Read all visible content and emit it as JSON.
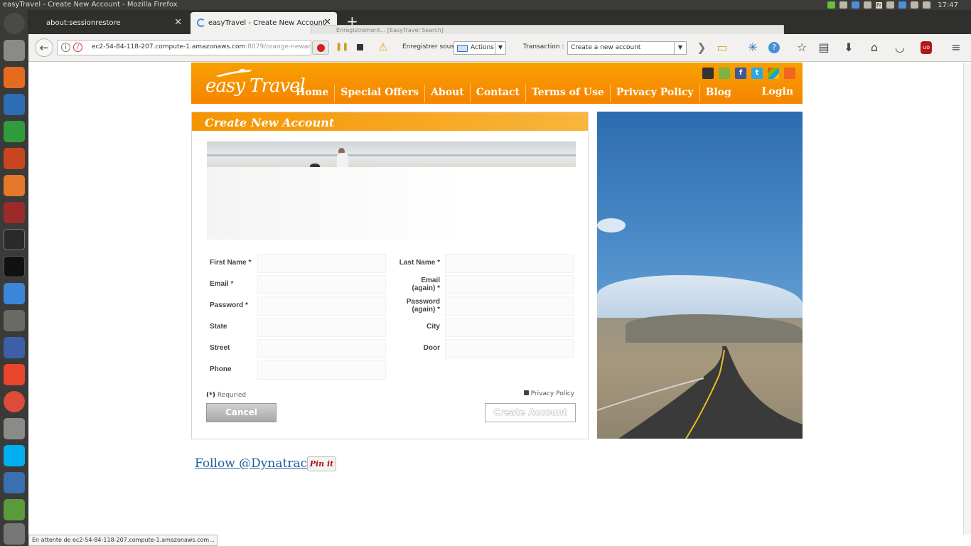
{
  "window": {
    "title": "easyTravel - Create New Account - Mozilla Firefox",
    "clock": "17:47",
    "keyboard_layout": "Fr"
  },
  "tabs": [
    {
      "label": "about:sessionrestore",
      "active": false
    },
    {
      "label": "easyTravel - Create New Account",
      "active": true
    }
  ],
  "recorder_bar": {
    "text": "Enregistrement... [EasyTravel  Search]"
  },
  "navbar": {
    "url_host": "ec2-54-84-118-207.compute-1.amazonaws.com",
    "url_rest": ":8079/orange-newaccount.jsf",
    "save_label": "Enregistrer sous :",
    "actions_value": "Actions",
    "transaction_label": "Transaction :",
    "transaction_value": "Create a new account"
  },
  "site": {
    "logo": "easy Travel",
    "nav": [
      "Home",
      "Special Offers",
      "About",
      "Contact",
      "Terms of Use",
      "Privacy Policy",
      "Blog"
    ],
    "login": "Login",
    "social_icons": [
      "apple-icon",
      "android-icon",
      "facebook-icon",
      "twitter-icon",
      "windows-icon",
      "rss-icon"
    ]
  },
  "form": {
    "title": "Create New Account",
    "fields": [
      {
        "left": "First Name",
        "left_req": "*",
        "right": "Last Name",
        "right_req": "*"
      },
      {
        "left": "Email",
        "left_req": "*",
        "right": "Email (again)",
        "right_req": "*"
      },
      {
        "left": "Password",
        "left_req": "*",
        "right": "Password (again)",
        "right_req": "*"
      },
      {
        "left": "State",
        "left_req": "",
        "right": "City",
        "right_req": ""
      },
      {
        "left": "Street",
        "left_req": "",
        "right": "Door",
        "right_req": ""
      },
      {
        "left": "Phone",
        "left_req": "",
        "right": "",
        "right_req": ""
      }
    ],
    "required_mark": "(*)",
    "required_note": "Requried",
    "privacy_link": "Privacy Policy",
    "cancel": "Cancel",
    "create": "Create Account"
  },
  "footer": {
    "follow": "Follow @Dynatrace",
    "pinit": "Pin it"
  },
  "status": "En attente de ec2-54-84-118-207.compute-1.amazonaws.com...",
  "colors": {
    "brand_orange": "#f59400",
    "link": "#1f5e9e",
    "firefox_chrome": "#f2f1f0"
  }
}
